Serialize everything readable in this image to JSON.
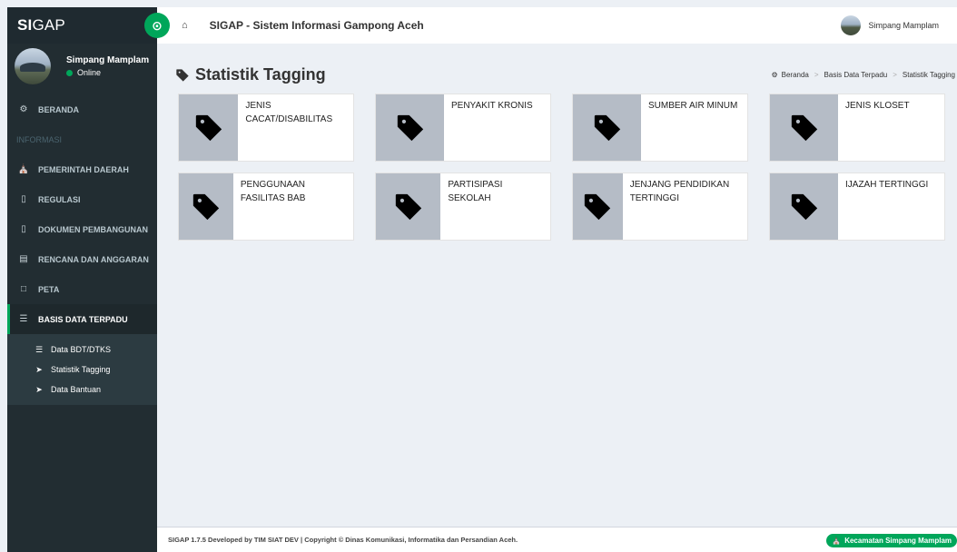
{
  "logo": {
    "bold": "SI",
    "thin": "GAP"
  },
  "user": {
    "name": "Simpang Mamplam",
    "status": "Online"
  },
  "menu": {
    "beranda": "BERANDA",
    "header_informasi": "INFORMASI",
    "pemerintah": "PEMERINTAH DAERAH",
    "regulasi": "REGULASI",
    "dokumen": "DOKUMEN PEMBANGUNAN",
    "rencana": "RENCANA DAN ANGGARAN",
    "peta": "PETA",
    "basis": "BASIS DATA TERPADU"
  },
  "submenu": {
    "bdt": "Data BDT/DTKS",
    "tagging": "Statistik Tagging",
    "bantuan": "Data Bantuan"
  },
  "topbar": {
    "title": "SIGAP - Sistem Informasi Gampong Aceh",
    "user": "Simpang Mamplam"
  },
  "page": {
    "title": "Statistik Tagging"
  },
  "breadcrumb": {
    "home": "Beranda",
    "parent": "Basis Data Terpadu",
    "current": "Statistik Tagging"
  },
  "cards": [
    "JENIS CACAT/DISABILITAS",
    "PENYAKIT KRONIS",
    "SUMBER AIR MINUM",
    "JENIS KLOSET",
    "PENGGUNAAN FASILITAS BAB",
    "PARTISIPASI SEKOLAH",
    "JENJANG PENDIDIKAN TERTINGGI",
    "IJAZAH TERTINGGI"
  ],
  "footer": {
    "text": "SIGAP 1.7.5 Developed by TIM SIAT DEV | Copyright © Dinas Komunikasi, Informatika dan Persandian Aceh.",
    "badge": "Kecamatan Simpang Mamplam"
  },
  "colors": {
    "accent": "#00a65a",
    "sidebar": "#222d32",
    "icon_bg": "#b5bcc6"
  },
  "icons": {
    "toggle": "circle-arrow-icon",
    "home": "home-icon",
    "tag": "tag-icon",
    "dashboard": "dashboard-icon"
  }
}
